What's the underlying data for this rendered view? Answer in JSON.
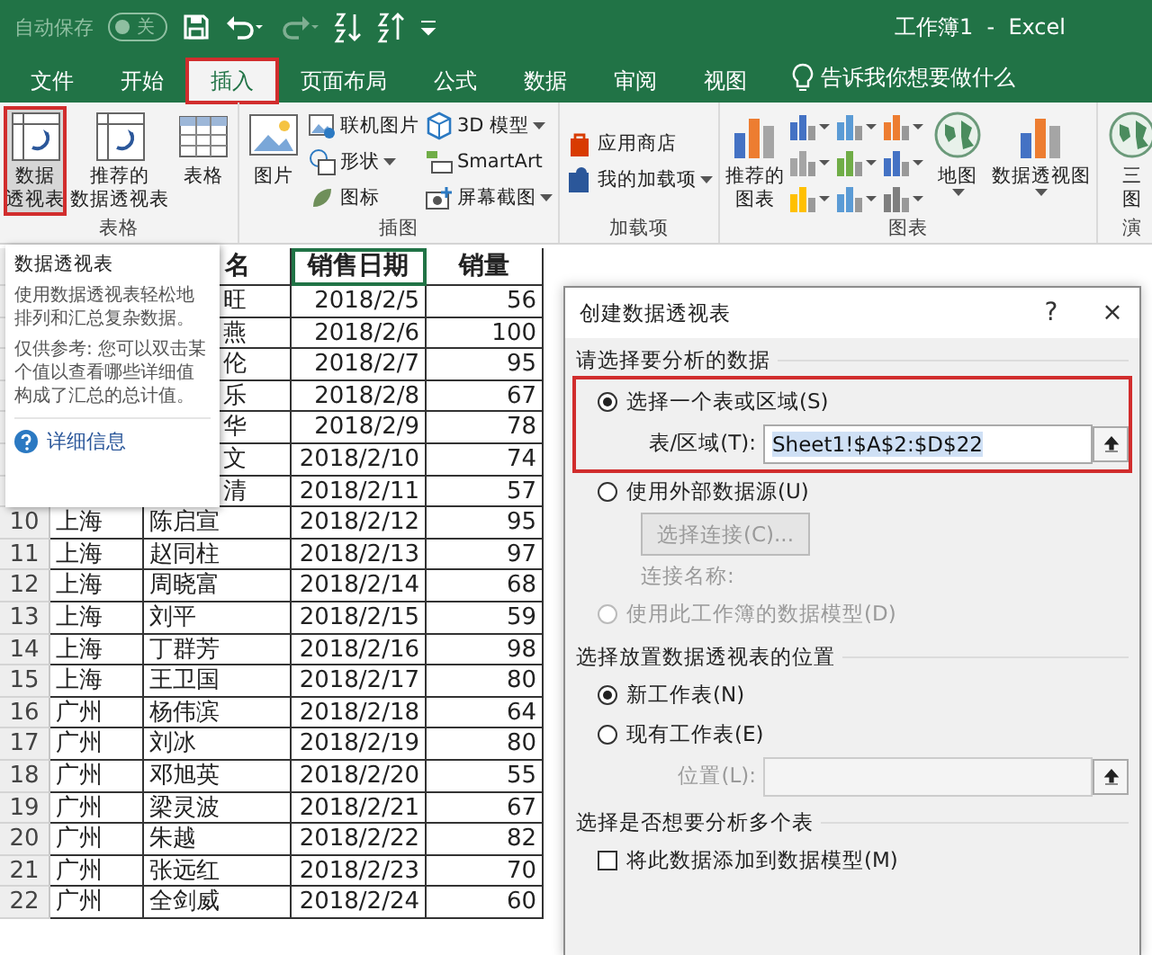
{
  "title_bar": {
    "autosave": {
      "label": "自动保存",
      "toggle": "关",
      "on": false
    },
    "title": "工作簿1  -  Excel"
  },
  "tabs": [
    {
      "label": "文件",
      "selected": false,
      "highlighted": false
    },
    {
      "label": "开始",
      "selected": false,
      "highlighted": false
    },
    {
      "label": "插入",
      "selected": true,
      "highlighted": true
    },
    {
      "label": "页面布局",
      "selected": false,
      "highlighted": false
    },
    {
      "label": "公式",
      "selected": false,
      "highlighted": false
    },
    {
      "label": "数据",
      "selected": false,
      "highlighted": false
    },
    {
      "label": "审阅",
      "selected": false,
      "highlighted": false
    },
    {
      "label": "视图",
      "selected": false,
      "highlighted": false
    }
  ],
  "tell_me": "告诉我你想要做什么",
  "ribbon_groups": [
    {
      "label": "表格",
      "columns": [
        {
          "kind": "large",
          "lines": [
            "数据",
            "透视表"
          ],
          "highlighted": true,
          "dropdown": false
        },
        {
          "kind": "large",
          "lines": [
            "推荐的",
            "数据透视表"
          ],
          "highlighted": false,
          "dropdown": false
        },
        {
          "kind": "large",
          "lines": [
            "表格"
          ],
          "highlighted": false,
          "dropdown": false
        }
      ]
    },
    {
      "label": "插图",
      "columns": [
        {
          "kind": "large",
          "lines": [
            "图片"
          ],
          "highlighted": false,
          "dropdown": false
        },
        {
          "kind": "stack",
          "items": [
            {
              "label": "联机图片",
              "dropdown": false
            },
            {
              "label": "形状",
              "dropdown": true
            },
            {
              "label": "图标",
              "dropdown": false
            }
          ]
        },
        {
          "kind": "stack",
          "items": [
            {
              "label": "3D 模型",
              "dropdown": true
            },
            {
              "label": "SmartArt",
              "dropdown": false
            },
            {
              "label": "屏幕截图",
              "dropdown": true
            }
          ]
        }
      ]
    },
    {
      "label": "加载项",
      "columns": [
        {
          "kind": "stack",
          "items": [
            {
              "label": "应用商店",
              "dropdown": false
            },
            {
              "label": "我的加载项",
              "dropdown": true
            }
          ]
        }
      ]
    },
    {
      "label": "图表",
      "columns": [
        {
          "kind": "large",
          "lines": [
            "推荐的",
            "图表"
          ],
          "highlighted": false,
          "dropdown": false
        },
        {
          "kind": "chart-grid"
        },
        {
          "kind": "large",
          "lines": [
            "地图"
          ],
          "highlighted": false,
          "dropdown": true
        },
        {
          "kind": "large",
          "lines": [
            "数据透视图"
          ],
          "highlighted": false,
          "dropdown": true
        }
      ]
    },
    {
      "label": "演",
      "columns": [
        {
          "kind": "large",
          "lines": [
            "三",
            "图"
          ],
          "highlighted": false,
          "dropdown": false
        }
      ]
    }
  ],
  "sheet": {
    "columns": [
      {
        "label": "名",
        "selected": false
      },
      {
        "label": "销售日期",
        "selected": true
      },
      {
        "label": "销量",
        "selected": false
      }
    ],
    "rows": [
      {
        "number": "",
        "city": "",
        "name": "旺",
        "date": "2018/2/5",
        "sales": "56"
      },
      {
        "number": "",
        "city": "",
        "name": "燕",
        "date": "2018/2/6",
        "sales": "100"
      },
      {
        "number": "",
        "city": "",
        "name": "伦",
        "date": "2018/2/7",
        "sales": "95"
      },
      {
        "number": "",
        "city": "",
        "name": "乐",
        "date": "2018/2/8",
        "sales": "67"
      },
      {
        "number": "",
        "city": "",
        "name": "华",
        "date": "2018/2/9",
        "sales": "78"
      },
      {
        "number": "",
        "city": "",
        "name": "文",
        "date": "2018/2/10",
        "sales": "74"
      },
      {
        "number": "",
        "city": "",
        "name": "清",
        "date": "2018/2/11",
        "sales": "57"
      },
      {
        "number": "10",
        "city": "上海",
        "name": "陈启宣",
        "date": "2018/2/12",
        "sales": "95"
      },
      {
        "number": "11",
        "city": "上海",
        "name": "赵同柱",
        "date": "2018/2/13",
        "sales": "97"
      },
      {
        "number": "12",
        "city": "上海",
        "name": "周晓富",
        "date": "2018/2/14",
        "sales": "68"
      },
      {
        "number": "13",
        "city": "上海",
        "name": "刘平",
        "date": "2018/2/15",
        "sales": "59"
      },
      {
        "number": "14",
        "city": "上海",
        "name": "丁群芳",
        "date": "2018/2/16",
        "sales": "98"
      },
      {
        "number": "15",
        "city": "上海",
        "name": "王卫国",
        "date": "2018/2/17",
        "sales": "80"
      },
      {
        "number": "16",
        "city": "广州",
        "name": "杨伟滨",
        "date": "2018/2/18",
        "sales": "64"
      },
      {
        "number": "17",
        "city": "广州",
        "name": "刘冰",
        "date": "2018/2/19",
        "sales": "80"
      },
      {
        "number": "18",
        "city": "广州",
        "name": "邓旭英",
        "date": "2018/2/20",
        "sales": "55"
      },
      {
        "number": "19",
        "city": "广州",
        "name": "梁灵波",
        "date": "2018/2/21",
        "sales": "67"
      },
      {
        "number": "20",
        "city": "广州",
        "name": "朱越",
        "date": "2018/2/22",
        "sales": "82"
      },
      {
        "number": "21",
        "city": "广州",
        "name": "张远红",
        "date": "2018/2/23",
        "sales": "70"
      },
      {
        "number": "22",
        "city": "广州",
        "name": "全剑威",
        "date": "2018/2/24",
        "sales": "60"
      }
    ]
  },
  "tooltip": {
    "title": "数据透视表",
    "paragraphs": [
      "使用数据透视表轻松地排列和汇总复杂数据。",
      "仅供参考: 您可以双击某个值以查看哪些详细值构成了汇总的总计值。"
    ],
    "link": "详细信息"
  },
  "dialog": {
    "title": "创建数据透视表",
    "help": "?",
    "close": "×",
    "sections": [
      {
        "title": "请选择要分析的数据",
        "items": [
          {
            "kind": "box",
            "highlighted": true,
            "items": [
              {
                "kind": "radio",
                "label": "选择一个表或区域(S)",
                "selected": true,
                "disabled": false
              },
              {
                "kind": "field",
                "label": "表/区域(T):",
                "value": "Sheet1!$A$2:$D$22",
                "disabled": false
              }
            ]
          },
          {
            "kind": "radio",
            "label": "使用外部数据源(U)",
            "selected": false,
            "disabled": false
          },
          {
            "kind": "button",
            "label": "选择连接(C)...",
            "disabled": true
          },
          {
            "kind": "note",
            "label": "连接名称:",
            "disabled": true
          },
          {
            "kind": "radio",
            "label": "使用此工作簿的数据模型(D)",
            "selected": false,
            "disabled": true
          }
        ]
      },
      {
        "title": "选择放置数据透视表的位置",
        "items": [
          {
            "kind": "radio",
            "label": "新工作表(N)",
            "selected": true,
            "disabled": false
          },
          {
            "kind": "radio",
            "label": "现有工作表(E)",
            "selected": false,
            "disabled": false
          },
          {
            "kind": "field",
            "label": "位置(L):",
            "value": "",
            "disabled": true
          }
        ]
      },
      {
        "title": "选择是否想要分析多个表",
        "items": [
          {
            "kind": "checkbox",
            "label": "将此数据添加到数据模型(M)",
            "checked": false,
            "disabled": false
          }
        ]
      }
    ]
  }
}
